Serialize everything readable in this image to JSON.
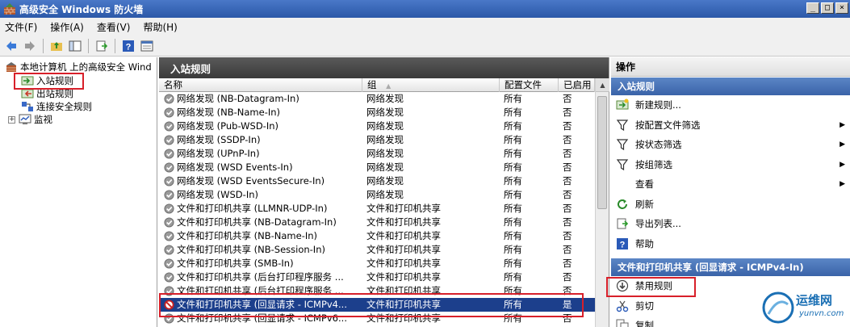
{
  "window": {
    "title": "高级安全 Windows 防火墙",
    "controls": [
      "_",
      "□",
      "×"
    ]
  },
  "menu": [
    "文件(F)",
    "操作(A)",
    "查看(V)",
    "帮助(H)"
  ],
  "toolbar": {
    "icons": [
      "back-icon",
      "forward-icon",
      "up-folder-icon",
      "show-hide-tree-icon",
      "export-icon",
      "help-icon",
      "properties-icon"
    ]
  },
  "tree": {
    "root": "本地计算机 上的高级安全 Wind",
    "items": [
      "入站规则",
      "出站规则",
      "连接安全规则",
      "监视"
    ],
    "expander": "+"
  },
  "center": {
    "title": "入站规则",
    "columns": [
      "名称",
      "组",
      "配置文件",
      "已启用"
    ],
    "sort_indicator": "▲",
    "rows": [
      {
        "name": "网络发现 (NB-Datagram-In)",
        "group": "网络发现",
        "profile": "所有",
        "enabled": "否"
      },
      {
        "name": "网络发现 (NB-Name-In)",
        "group": "网络发现",
        "profile": "所有",
        "enabled": "否"
      },
      {
        "name": "网络发现 (Pub-WSD-In)",
        "group": "网络发现",
        "profile": "所有",
        "enabled": "否"
      },
      {
        "name": "网络发现 (SSDP-In)",
        "group": "网络发现",
        "profile": "所有",
        "enabled": "否"
      },
      {
        "name": "网络发现 (UPnP-In)",
        "group": "网络发现",
        "profile": "所有",
        "enabled": "否"
      },
      {
        "name": "网络发现 (WSD Events-In)",
        "group": "网络发现",
        "profile": "所有",
        "enabled": "否"
      },
      {
        "name": "网络发现 (WSD EventsSecure-In)",
        "group": "网络发现",
        "profile": "所有",
        "enabled": "否"
      },
      {
        "name": "网络发现 (WSD-In)",
        "group": "网络发现",
        "profile": "所有",
        "enabled": "否"
      },
      {
        "name": "文件和打印机共享 (LLMNR-UDP-In)",
        "group": "文件和打印机共享",
        "profile": "所有",
        "enabled": "否"
      },
      {
        "name": "文件和打印机共享 (NB-Datagram-In)",
        "group": "文件和打印机共享",
        "profile": "所有",
        "enabled": "否"
      },
      {
        "name": "文件和打印机共享 (NB-Name-In)",
        "group": "文件和打印机共享",
        "profile": "所有",
        "enabled": "否"
      },
      {
        "name": "文件和打印机共享 (NB-Session-In)",
        "group": "文件和打印机共享",
        "profile": "所有",
        "enabled": "否"
      },
      {
        "name": "文件和打印机共享 (SMB-In)",
        "group": "文件和打印机共享",
        "profile": "所有",
        "enabled": "否"
      },
      {
        "name": "文件和打印机共享 (后台打印程序服务 ...",
        "group": "文件和打印机共享",
        "profile": "所有",
        "enabled": "否"
      },
      {
        "name": "文件和打印机共享 (后台打印程序服务 ...",
        "group": "文件和打印机共享",
        "profile": "所有",
        "enabled": "否"
      },
      {
        "name": "文件和打印机共享 (回显请求 - ICMPv4...",
        "group": "文件和打印机共享",
        "profile": "所有",
        "enabled": "是",
        "selected": true
      },
      {
        "name": "文件和打印机共享 (回显请求 - ICMPv6...",
        "group": "文件和打印机共享",
        "profile": "所有",
        "enabled": "否"
      }
    ]
  },
  "actions": {
    "title": "操作",
    "section1": "入站规则",
    "items1": [
      {
        "label": "新建规则...",
        "icon": "new-rule-icon",
        "sub": false
      },
      {
        "label": "按配置文件筛选",
        "icon": "filter-icon",
        "sub": true
      },
      {
        "label": "按状态筛选",
        "icon": "filter-icon",
        "sub": true
      },
      {
        "label": "按组筛选",
        "icon": "filter-icon",
        "sub": true
      },
      {
        "label": "查看",
        "icon": "",
        "sub": true
      },
      {
        "label": "刷新",
        "icon": "refresh-icon",
        "sub": false
      },
      {
        "label": "导出列表...",
        "icon": "export-list-icon",
        "sub": false
      },
      {
        "label": "帮助",
        "icon": "help-icon",
        "sub": false
      }
    ],
    "section2": "文件和打印机共享 (回显请求 - ICMPv4-In)",
    "items2": [
      {
        "label": "禁用规则",
        "icon": "disable-rule-icon"
      },
      {
        "label": "剪切",
        "icon": "cut-icon"
      },
      {
        "label": "复制",
        "icon": "copy-icon"
      }
    ],
    "submenu_arrow": "▶"
  },
  "watermark": {
    "text": "运维网",
    "url": "yunvn.com"
  },
  "colors": {
    "selected_row": "#1c3f8c",
    "highlight_box": "#d8202a",
    "section_header": "#4a74b8"
  }
}
